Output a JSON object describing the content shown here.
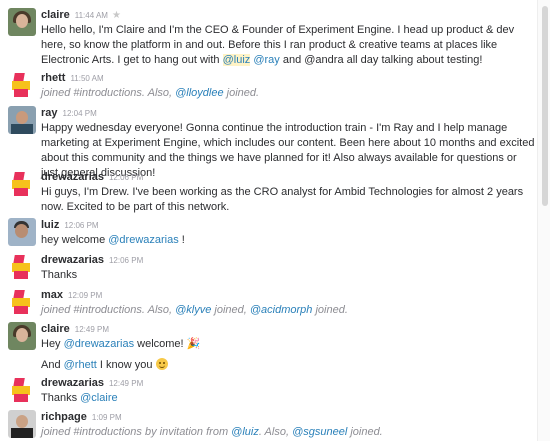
{
  "messages": [
    {
      "user": "claire",
      "time": "11:44 AM",
      "text_a": "Hello hello, I'm Claire and I'm the CEO & Founder of Experiment Engine. I head up product & dev here, so know the platform in and out. Before this I ran product & creative teams at places like Electronic Arts. I get to hang out with ",
      "mention_1": "@luiz",
      "mention_2": "@ray",
      "text_b": " and @andra all day talking about testing!"
    },
    {
      "user": "rhett",
      "time": "11:50 AM",
      "text_a": "joined #introductions. Also, ",
      "mention_1": "@lloydlee",
      "text_b": " joined."
    },
    {
      "user": "ray",
      "time": "12:04 PM",
      "text": "Happy wednesday everyone! Gonna continue the introduction train - I'm Ray and I help manage marketing at Experiment Engine, which includes our content. Been here about 10 months and excited about this community and the things we have planned for it! Also always available for questions or just general discussion!"
    },
    {
      "user": "drewazarias",
      "time": "12:06 PM",
      "text": "Hi guys, I'm Drew. I've been working as the CRO analyst for Ambid Technologies for almost 2 years now. Excited to be part of this network."
    },
    {
      "user": "luiz",
      "time": "12:06 PM",
      "text_a": "hey welcome ",
      "mention_1": "@drewazarias",
      "text_b": " !"
    },
    {
      "user": "drewazarias",
      "time": "12:06 PM",
      "text": "Thanks"
    },
    {
      "user": "max",
      "time": "12:09 PM",
      "text_a": "joined #introductions. Also, ",
      "mention_1": "@klyve",
      "text_b": " joined, ",
      "mention_2": "@acidmorph",
      "text_c": " joined."
    },
    {
      "user": "claire",
      "time": "12:49 PM",
      "text_a": "Hey ",
      "mention_1": "@drewazarias",
      "text_b": " welcome! ",
      "text_c": "And ",
      "mention_2": "@rhett",
      "text_d": " I know you "
    },
    {
      "user": "drewazarias",
      "time": "12:49 PM",
      "text_a": "Thanks ",
      "mention_1": "@claire"
    },
    {
      "user": "richpage",
      "time": "1:09 PM",
      "text_a": "joined #introductions by invitation from ",
      "mention_1": "@luiz",
      "text_b": ". Also, ",
      "mention_2": "@sgsuneel",
      "text_c": " joined."
    }
  ],
  "icons": {
    "star": "star-icon",
    "party": "party-popper-emoji",
    "smile": "smiley-emoji"
  },
  "colors": {
    "mention": "#2a80b9",
    "highlight": "#fff3c6",
    "logo_red": "#e8315b",
    "logo_yellow": "#f6c21c"
  }
}
